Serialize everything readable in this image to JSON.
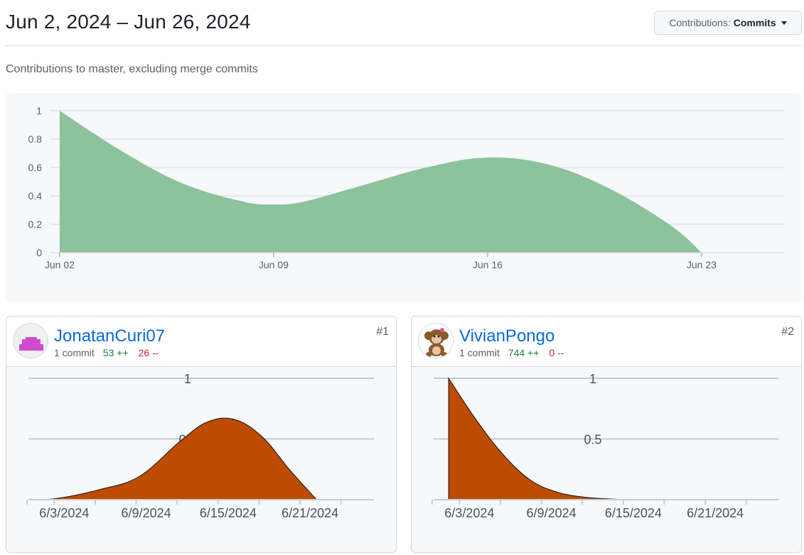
{
  "header": {
    "range_title": "Jun 2, 2024 – Jun 26, 2024",
    "contributions_label": "Contributions:",
    "contributions_value": "Commits"
  },
  "subtitle": "Contributions to master, excluding merge commits",
  "colors": {
    "main_area": "#8cc29c",
    "user_area": "#bd4b00",
    "link": "#0969da",
    "additions": "#1a7f37",
    "deletions": "#cf222e"
  },
  "chart_data": [
    {
      "type": "area",
      "y_ticks": [
        "0",
        "0.2",
        "0.4",
        "0.6",
        "0.8",
        "1"
      ],
      "x_ticks": [
        "Jun 02",
        "Jun 09",
        "Jun 16",
        "Jun 23"
      ],
      "ylim": [
        0,
        1
      ],
      "grid": true,
      "x": [
        "Jun 02",
        "Jun 04",
        "Jun 06",
        "Jun 08",
        "Jun 09",
        "Jun 10",
        "Jun 12",
        "Jun 14",
        "Jun 16",
        "Jun 18",
        "Jun 20",
        "Jun 22",
        "Jun 23"
      ],
      "values": [
        1,
        0.72,
        0.49,
        0.36,
        0.34,
        0.36,
        0.48,
        0.6,
        0.67,
        0.62,
        0.45,
        0.19,
        0
      ]
    },
    {
      "type": "area",
      "y_ticks": [
        "1",
        "0.5"
      ],
      "x_ticks": [
        "6/3/2024",
        "6/9/2024",
        "6/15/2024",
        "6/21/2024"
      ],
      "ylim": [
        0,
        1
      ],
      "grid": true,
      "x": [
        "6/1/2024",
        "6/3/2024",
        "6/6/2024",
        "6/9/2024",
        "6/12/2024",
        "6/14/2024",
        "6/16/2024",
        "6/18/2024",
        "6/20/2024",
        "6/22/2024"
      ],
      "values": [
        0,
        0.01,
        0.08,
        0.19,
        0.48,
        0.64,
        0.66,
        0.52,
        0.25,
        0
      ]
    },
    {
      "type": "area",
      "y_ticks": [
        "1",
        "0.5"
      ],
      "x_ticks": [
        "6/3/2024",
        "6/9/2024",
        "6/15/2024",
        "6/21/2024"
      ],
      "ylim": [
        0,
        1
      ],
      "grid": true,
      "x": [
        "6/2/2024",
        "6/4/2024",
        "6/6/2024",
        "6/8/2024",
        "6/10/2024",
        "6/12/2024",
        "6/14/2024",
        "6/16/2024"
      ],
      "values": [
        1,
        0.66,
        0.37,
        0.16,
        0.06,
        0.02,
        0.005,
        0
      ]
    }
  ],
  "contributors": [
    {
      "name": "JonatanCuri07",
      "commits": "1 commit",
      "additions": "53 ++",
      "deletions": "26 --",
      "rank": "#1"
    },
    {
      "name": "VivianPongo",
      "commits": "1 commit",
      "additions": "744 ++",
      "deletions": "0 --",
      "rank": "#2"
    }
  ]
}
